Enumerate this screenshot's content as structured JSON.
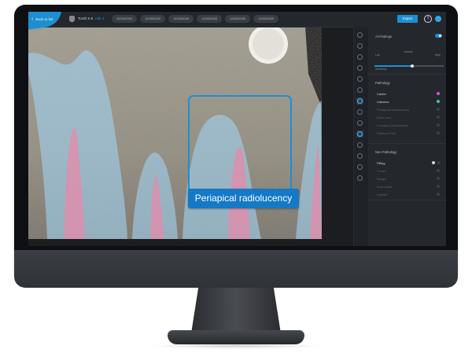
{
  "topbar": {
    "back_label": "Back to list",
    "tooth_title": "Tooth 5-8",
    "tooth_sub": "edit 4",
    "dates": [
      "12/20/2020",
      "12/20/2020",
      "12/20/2020",
      "12/20/2020",
      "12/20/2020",
      "12/20/2020"
    ],
    "export_label": "Export",
    "help_label": "?"
  },
  "panel": {
    "ai_findings": {
      "title": "AI Findings",
      "enabled": true,
      "slider_labels": [
        "Low",
        "Normal",
        "High"
      ],
      "threshold_label": "Sensitivity"
    },
    "pathology": {
      "title": "Pathology",
      "items": [
        {
          "label": "Caries",
          "color": "#e54fd0",
          "active": true
        },
        {
          "label": "Calculus",
          "color": "#2ed1a8",
          "active": true
        },
        {
          "label": "Periapical radiolucency",
          "active": false
        },
        {
          "label": "Bone loss",
          "active": false
        },
        {
          "label": "Furcation involvement",
          "active": false
        },
        {
          "label": "Widened PDL",
          "active": false
        }
      ]
    },
    "non_pathology": {
      "title": "Non Pathology",
      "items": [
        {
          "label": "Filling",
          "active": true
        },
        {
          "label": "Crown",
          "active": false
        },
        {
          "label": "Bridge",
          "active": false
        },
        {
          "label": "Root canal",
          "active": false
        },
        {
          "label": "Implant",
          "active": false
        }
      ]
    }
  },
  "annotation": {
    "label": "Periapical radiolucency"
  },
  "colors": {
    "accent": "#1d8fd0",
    "tooth_overlay": "#9fd0ef",
    "pulp_overlay": "#e58aa8",
    "callout": "#1479c7"
  }
}
